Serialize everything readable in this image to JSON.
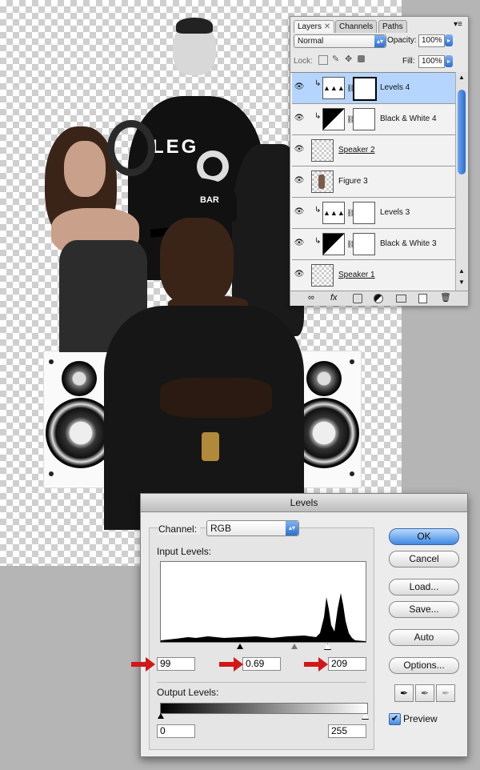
{
  "layers_panel": {
    "tabs": [
      "Layers",
      "Channels",
      "Paths"
    ],
    "blend_mode": "Normal",
    "opacity_label": "Opacity:",
    "opacity_value": "100%",
    "lock_label": "Lock:",
    "fill_label": "Fill:",
    "fill_value": "100%",
    "layers": [
      {
        "name": "Levels 4",
        "selected": true
      },
      {
        "name": "Black & White 4",
        "selected": false
      },
      {
        "name": "Speaker 2",
        "selected": false
      },
      {
        "name": "Figure 3",
        "selected": false
      },
      {
        "name": "Levels 3",
        "selected": false
      },
      {
        "name": "Black & White 3",
        "selected": false
      },
      {
        "name": "Speaker 1",
        "selected": false
      }
    ],
    "footer_icons": [
      "link-icon",
      "fx-icon",
      "mask-icon",
      "adjustment-icon",
      "group-icon",
      "new-layer-icon",
      "trash-icon"
    ]
  },
  "levels_dialog": {
    "title": "Levels",
    "channel_label": "Channel:",
    "channel_value": "RGB",
    "input_levels_label": "Input Levels:",
    "input_black": "99",
    "input_gamma": "0.69",
    "input_white": "209",
    "output_levels_label": "Output Levels:",
    "output_black": "0",
    "output_white": "255",
    "buttons": {
      "ok": "OK",
      "cancel": "Cancel",
      "load": "Load...",
      "save": "Save...",
      "auto": "Auto",
      "options": "Options..."
    },
    "preview_label": "Preview",
    "preview_checked": true
  },
  "colors": {
    "accent": "#3f88e2",
    "selected_row": "#b5d5ff",
    "annotation_arrow": "#d01818"
  }
}
